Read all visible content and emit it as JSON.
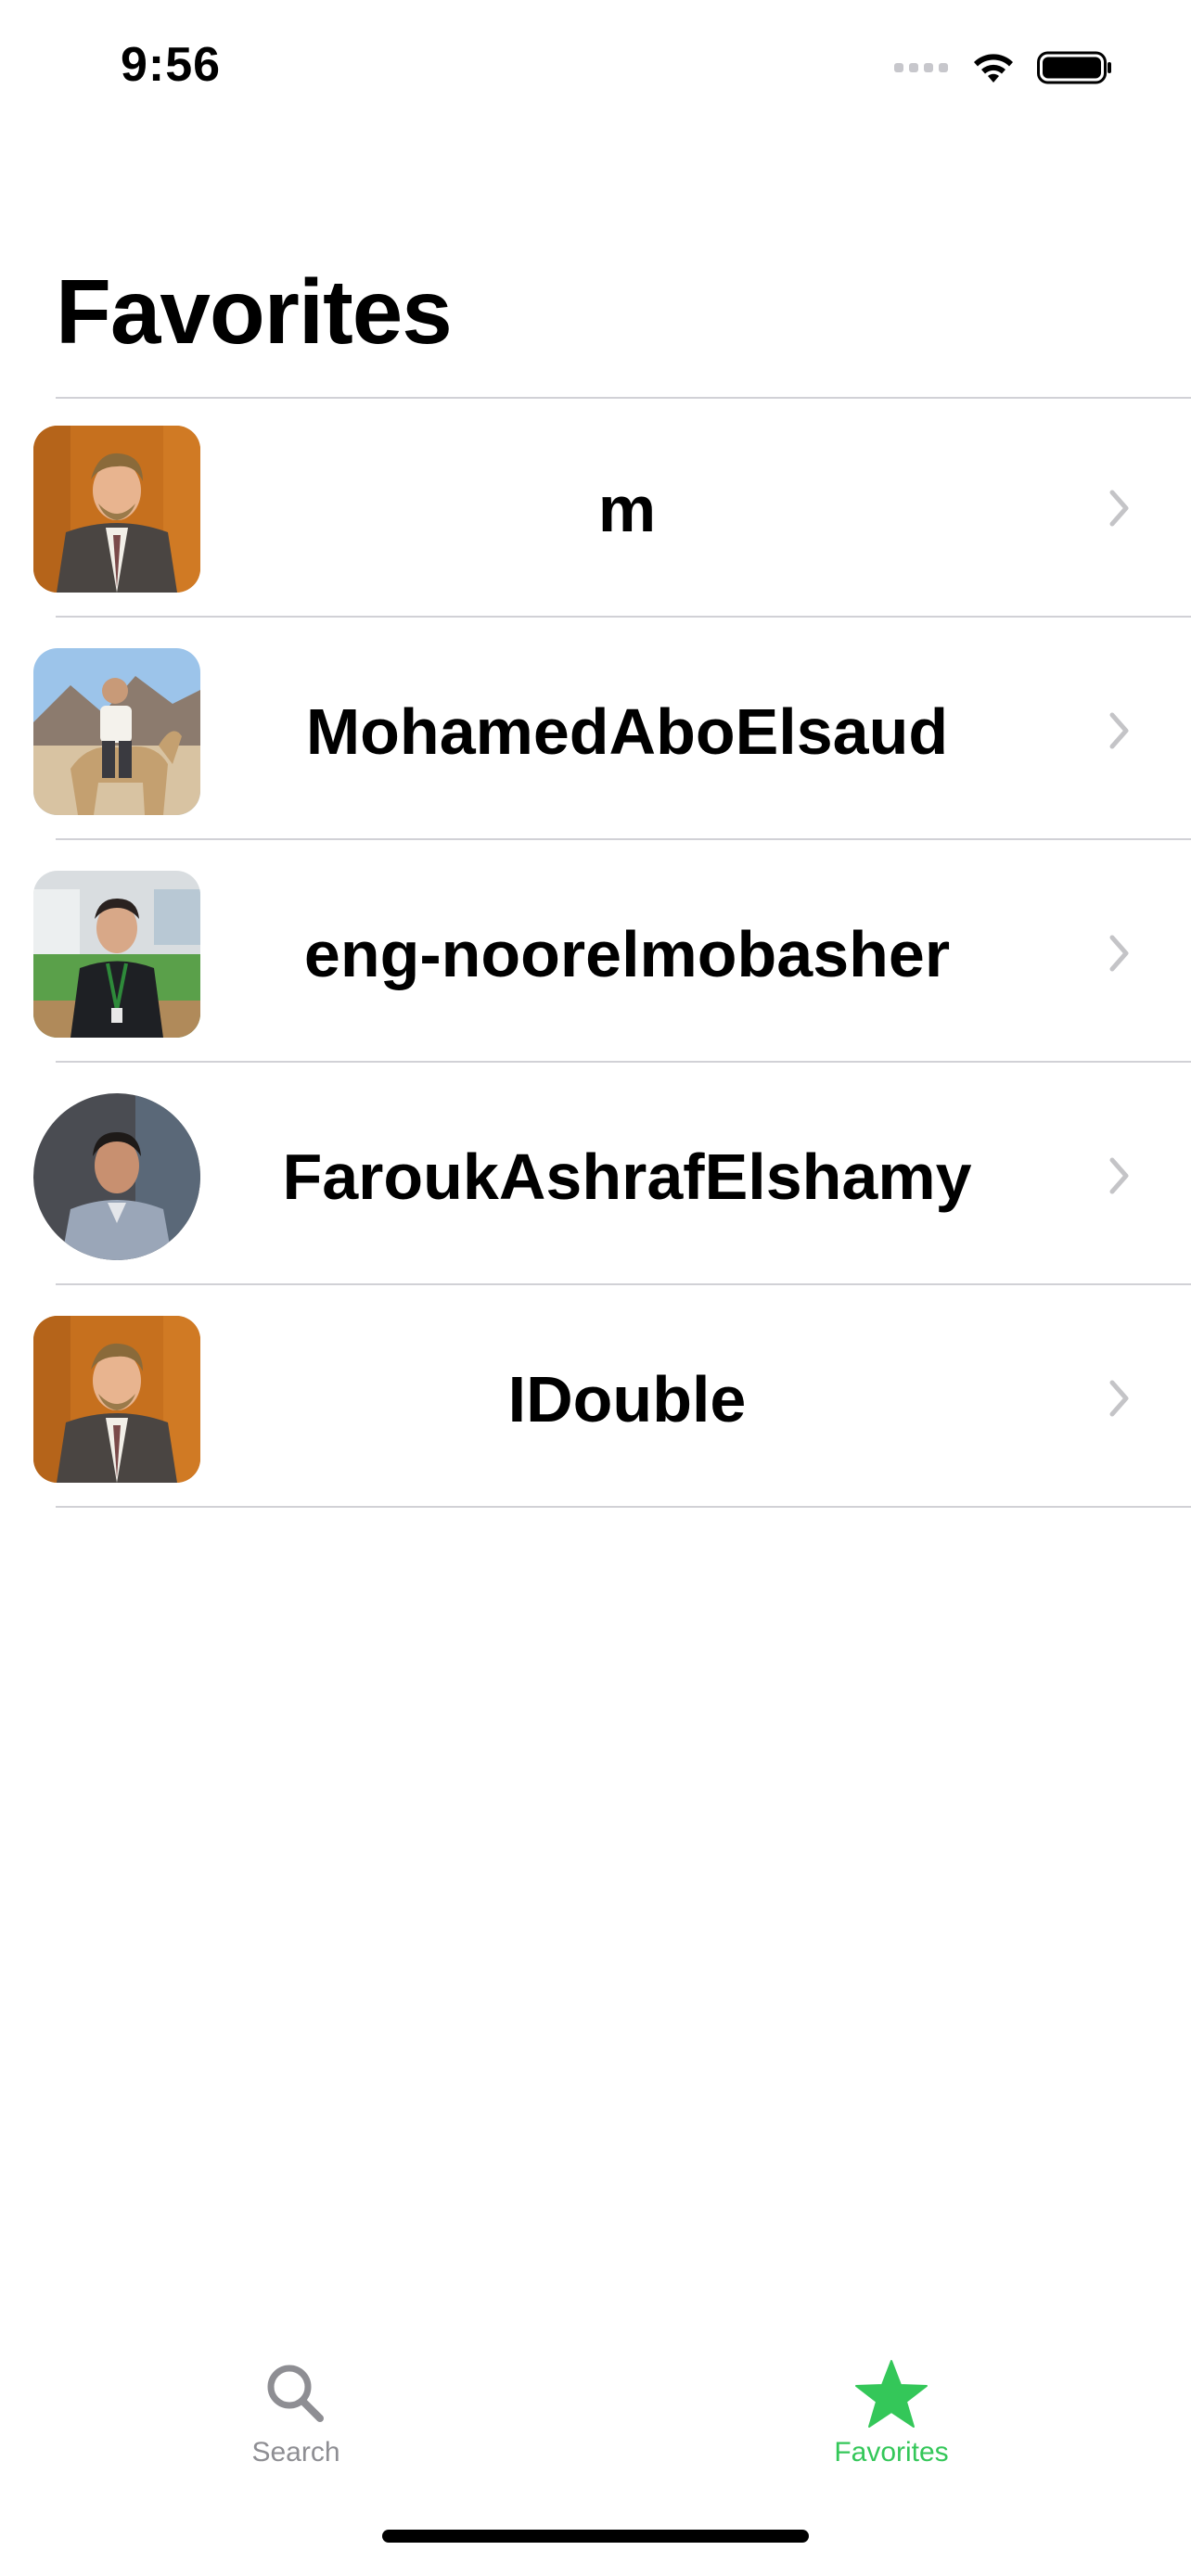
{
  "status_bar": {
    "time": "9:56"
  },
  "header": {
    "title": "Favorites"
  },
  "favorites": [
    {
      "name": "m",
      "avatar": "avatar-man-in-suit"
    },
    {
      "name": "MohamedAboElsaud",
      "avatar": "avatar-man-on-camel"
    },
    {
      "name": "eng-noorelmobasher",
      "avatar": "avatar-man-with-lanyard"
    },
    {
      "name": "FaroukAshrafElshamy",
      "avatar": "avatar-man-portrait"
    },
    {
      "name": "IDouble",
      "avatar": "avatar-man-in-suit"
    }
  ],
  "tab_bar": {
    "search_label": "Search",
    "favorites_label": "Favorites",
    "active_tab": "Favorites",
    "accent_color": "#34c759",
    "inactive_color": "#8e8e93"
  }
}
